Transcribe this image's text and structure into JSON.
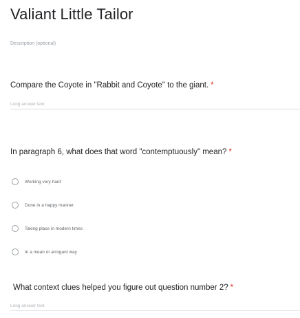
{
  "form": {
    "title": "Valiant Little Tailor",
    "description_placeholder": "Description (optional)"
  },
  "questions": [
    {
      "text": "Compare the Coyote in \"Rabbit and Coyote\" to the giant.",
      "required_mark": "*",
      "answer_placeholder": "Long answer text"
    },
    {
      "text": "In paragraph 6, what does that word \"contemptuously\" mean?",
      "required_mark": "*",
      "options": [
        "Working very hard",
        "Done in a happy manner",
        "Taking place in modern times",
        "In a mean or arrogant way"
      ]
    },
    {
      "text": "What context clues helped you figure out question number 2?",
      "required_mark": "*",
      "answer_placeholder": "Long answer text"
    }
  ],
  "colors": {
    "required": "#d93025",
    "text": "#202124",
    "muted": "#9aa0a6",
    "divider": "#dadce0"
  }
}
